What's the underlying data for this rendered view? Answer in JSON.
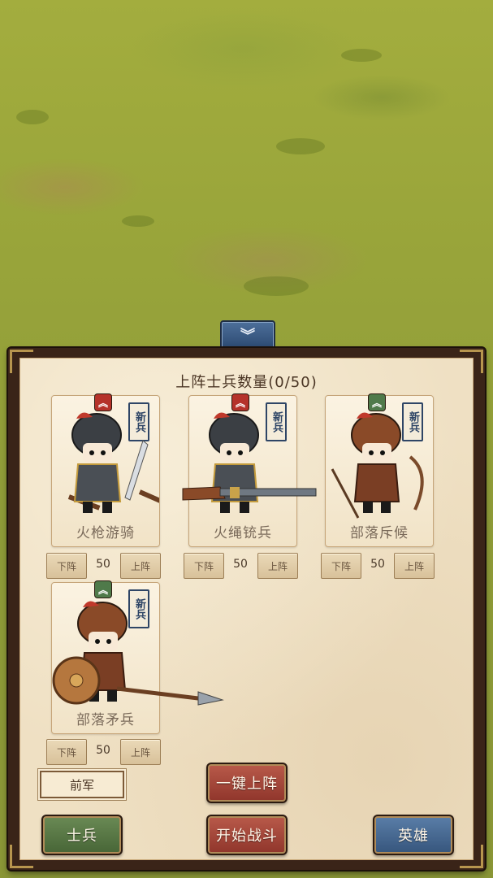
{
  "panel": {
    "title": "上阵士兵数量(0/50)",
    "collapse_icon": "chevron-double-down-icon"
  },
  "colors": {
    "panel_bg": "#efe0c3",
    "frame": "#3a2418",
    "btn_red": "#a5473b",
    "btn_green": "#57754a",
    "btn_blue": "#4a6d95",
    "rank_red": "#b5322a",
    "rank_green": "#4f7a4a"
  },
  "units": [
    {
      "name": "火枪游骑",
      "rank": "︽",
      "rank_color": "red",
      "tag": "新兵",
      "count": "50",
      "down_label": "下阵",
      "up_label": "上阵"
    },
    {
      "name": "火绳铳兵",
      "rank": "︽",
      "rank_color": "red",
      "tag": "新兵",
      "count": "50",
      "down_label": "下阵",
      "up_label": "上阵"
    },
    {
      "name": "部落斥候",
      "rank": "︽",
      "rank_color": "green",
      "tag": "新兵",
      "count": "50",
      "down_label": "下阵",
      "up_label": "上阵"
    },
    {
      "name": "部落矛兵",
      "rank": "︽",
      "rank_color": "green",
      "tag": "新兵",
      "count": "50",
      "down_label": "下阵",
      "up_label": "上阵"
    }
  ],
  "formation": {
    "selected": "前军"
  },
  "actions": {
    "deploy_all": "一键上阵",
    "soldiers": "士兵",
    "start_battle": "开始战斗",
    "heroes": "英雄"
  }
}
